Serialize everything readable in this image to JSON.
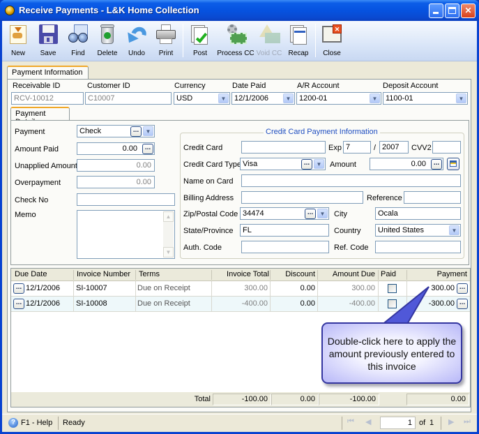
{
  "window": {
    "title": "Receive Payments - L&K Home Collection",
    "controls": {
      "minimize": "_",
      "maximize": "□",
      "close": "✕"
    }
  },
  "toolbar": {
    "items": [
      {
        "label": "New",
        "icon": "new-document-icon",
        "enabled": true
      },
      {
        "label": "Save",
        "icon": "floppy-disk-icon",
        "enabled": true
      },
      {
        "label": "Find",
        "icon": "binoculars-icon",
        "enabled": true
      },
      {
        "label": "Delete",
        "icon": "recycle-bin-icon",
        "enabled": true
      },
      {
        "label": "Undo",
        "icon": "undo-arrow-icon",
        "enabled": true
      },
      {
        "label": "Print",
        "icon": "printer-icon",
        "enabled": true
      },
      {
        "label": "Post",
        "icon": "post-checkmark-icon",
        "enabled": true
      },
      {
        "label": "Process CC",
        "icon": "process-cc-gear-icon",
        "enabled": true
      },
      {
        "label": "Void CC",
        "icon": "void-cc-warning-icon",
        "enabled": false
      },
      {
        "label": "Recap",
        "icon": "recap-document-icon",
        "enabled": true
      },
      {
        "label": "Close",
        "icon": "close-window-icon",
        "enabled": true
      }
    ]
  },
  "tabs": {
    "payment_information": "Payment Information",
    "payment_detail": "Payment Detail"
  },
  "header_fields": {
    "receivable_id": {
      "label": "Receivable ID",
      "value": "RCV-10012"
    },
    "customer_id": {
      "label": "Customer ID",
      "value": "C10007"
    },
    "currency": {
      "label": "Currency",
      "value": "USD"
    },
    "date_paid": {
      "label": "Date Paid",
      "value": "12/1/2006"
    },
    "ar_account": {
      "label": "A/R Account",
      "value": "1200-01"
    },
    "deposit_account": {
      "label": "Deposit Account",
      "value": "1100-01"
    }
  },
  "payment_detail": {
    "payment": {
      "label": "Payment",
      "value": "Check"
    },
    "amount_paid": {
      "label": "Amount Paid",
      "value": "0.00"
    },
    "unapplied_amount": {
      "label": "Unapplied Amount",
      "value": "0.00"
    },
    "overpayment": {
      "label": "Overpayment",
      "value": "0.00"
    },
    "check_no": {
      "label": "Check No",
      "value": ""
    },
    "memo": {
      "label": "Memo",
      "value": ""
    }
  },
  "credit_card": {
    "group_title": "Credit Card Payment Information",
    "credit_card": {
      "label": "Credit Card",
      "value": ""
    },
    "exp_label": "Exp",
    "exp_month": "7",
    "exp_separator": "/",
    "exp_year": "2007",
    "cvv2": {
      "label": "CVV2",
      "value": ""
    },
    "card_type": {
      "label": "Credit Card Type",
      "value": "Visa"
    },
    "amount": {
      "label": "Amount",
      "value": "0.00"
    },
    "name_on_card": {
      "label": "Name on Card",
      "value": ""
    },
    "billing_address": {
      "label": "Billing Address",
      "value": ""
    },
    "reference": {
      "label": "Reference",
      "value": ""
    },
    "zip": {
      "label": "Zip/Postal Code",
      "value": "34474"
    },
    "city": {
      "label": "City",
      "value": "Ocala"
    },
    "state": {
      "label": "State/Province",
      "value": "FL"
    },
    "country": {
      "label": "Country",
      "value": "United States"
    },
    "auth_code": {
      "label": "Auth. Code",
      "value": ""
    },
    "ref_code": {
      "label": "Ref. Code",
      "value": ""
    }
  },
  "grid": {
    "columns": [
      "Due Date",
      "Invoice Number",
      "Terms",
      "Invoice Total",
      "Discount",
      "Amount Due",
      "Paid",
      "Payment"
    ],
    "rows": [
      {
        "due_date": "12/1/2006",
        "invoice_number": "SI-10007",
        "terms": "Due on Receipt",
        "invoice_total": "300.00",
        "discount": "0.00",
        "amount_due": "300.00",
        "paid": false,
        "payment": "300.00"
      },
      {
        "due_date": "12/1/2006",
        "invoice_number": "SI-10008",
        "terms": "Due on Receipt",
        "invoice_total": "-400.00",
        "discount": "0.00",
        "amount_due": "-400.00",
        "paid": false,
        "payment": "-300.00"
      }
    ],
    "totals": {
      "label": "Total",
      "invoice_total": "-100.00",
      "discount": "0.00",
      "amount_due": "-100.00",
      "payment": "0.00"
    }
  },
  "callout": {
    "text": "Double-click here to apply the amount previously entered to this invoice"
  },
  "statusbar": {
    "help": "F1 - Help",
    "status": "Ready",
    "page_current": "1",
    "page_of": "of",
    "page_total": "1"
  },
  "colors": {
    "title_bar": "#0653e0",
    "tab_accent": "#f0a828",
    "group_title": "#1f4ec0",
    "callout_border": "#3436a0"
  }
}
